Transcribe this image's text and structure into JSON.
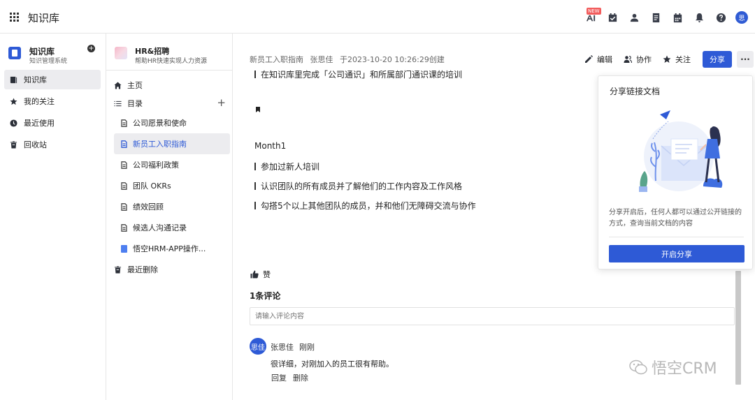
{
  "topbar": {
    "app_title": "知识库",
    "new_badge": "NEW",
    "avatar_text": "思",
    "icons": [
      "apps-grid-icon",
      "ai-icon",
      "task-check-icon",
      "contacts-icon",
      "document-icon",
      "calendar-icon",
      "bell-icon",
      "help-icon"
    ]
  },
  "leftnav": {
    "kb_name": "知识库",
    "kb_sub": "知识管理系统",
    "items": [
      {
        "label": "知识库",
        "icon": "book-icon",
        "active": true
      },
      {
        "label": "我的关注",
        "icon": "star-icon"
      },
      {
        "label": "最近使用",
        "icon": "clock-icon"
      },
      {
        "label": "回收站",
        "icon": "trash-icon"
      }
    ]
  },
  "tree": {
    "title": "HR&招聘",
    "subtitle": "帮助HR快速实现人力资源",
    "home": "主页",
    "catalog": "目录",
    "docs": [
      "公司愿景和使命",
      "新员工入职指南",
      "公司福利政策",
      "团队 OKRs",
      "绩效回顾",
      "候选人沟通记录",
      "悟空HRM-APP操作..."
    ],
    "active_index": 1,
    "recent_deleted": "最近删除"
  },
  "doc": {
    "name": "新员工入职指南",
    "author": "张思佳",
    "created": "于2023-10-20 10:26:29创建",
    "actions": {
      "edit": "编辑",
      "collab": "协作",
      "follow": "关注",
      "share": "分享",
      "more": "···"
    },
    "lines": [
      "在知识库里完成「公司通识」和所属部门通识课的培训",
      "Month1",
      "参加过新人培训",
      "认识团队的所有成员并了解他们的工作内容及工作风格",
      "勾搭5个以上其他团队的成员，并和他们无障碍交流与协作"
    ]
  },
  "feedback": {
    "like": "赞",
    "comments_title": "1条评论",
    "input_placeholder": "请输入评论内容",
    "comment": {
      "avatar": "思佳",
      "author": "张思佳",
      "time": "刚刚",
      "text": "很详细，对刚加入的员工很有帮助。",
      "reply": "回复",
      "delete": "删除"
    }
  },
  "share_popover": {
    "title": "分享链接文档",
    "description": "分享开启后，任何人都可以通过公开链接的方式，查询当前文档的内容",
    "button": "开启分享"
  },
  "watermark": "悟空CRM",
  "colors": {
    "accent": "#2e5ad6",
    "badge": "#f25b5b"
  }
}
